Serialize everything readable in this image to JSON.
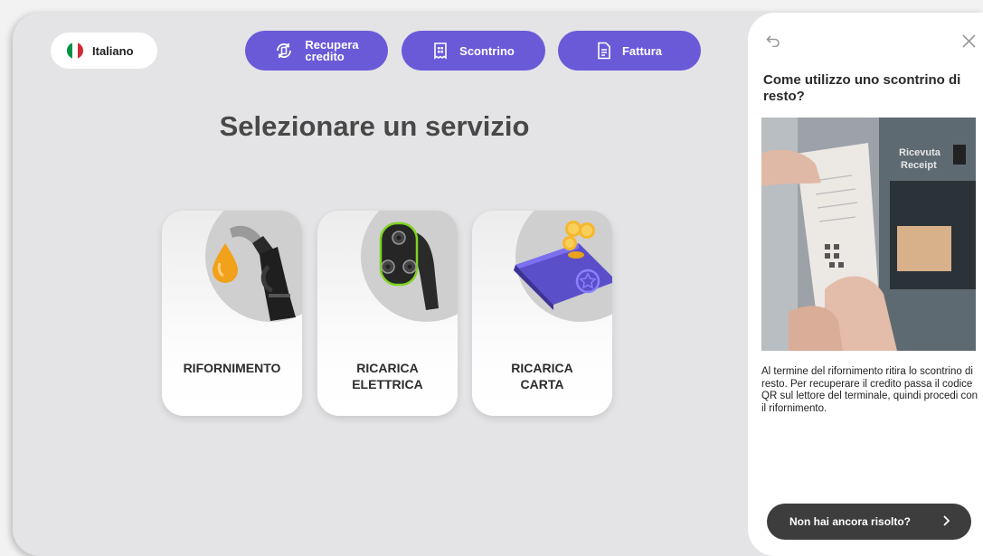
{
  "language": {
    "label": "Italiano",
    "flag_colors": [
      "#009246",
      "#ffffff",
      "#ce2b37"
    ]
  },
  "toolbar": {
    "recover": {
      "line1": "Recupera",
      "line2": "credito",
      "icon": "coin-refresh-icon"
    },
    "receipt": {
      "label": "Scontrino",
      "icon": "receipt-icon"
    },
    "invoice": {
      "label": "Fattura",
      "icon": "document-icon"
    }
  },
  "main": {
    "heading": "Selezionare un servizio",
    "services": [
      {
        "label": "RIFORNIMENTO",
        "icon": "fuel-nozzle-icon"
      },
      {
        "label": "RICARICA\nELETTRICA",
        "icon": "ev-plug-icon"
      },
      {
        "label": "RICARICA\nCARTA",
        "icon": "card-coins-icon"
      }
    ]
  },
  "help_panel": {
    "title": "Come utilizzo uno scontrino di resto?",
    "photo_sign": [
      "Ricevuta",
      "Receipt"
    ],
    "body": "Al termine del rifornimento ritira lo scontrino di resto. Per recuperare il credito passa il codice QR sul lettore del terminale, quindi procedi con il rifornimento.",
    "button_label": "Non hai ancora risolto?"
  },
  "colors": {
    "accent": "#6a5ad8",
    "background": "#e4e4e6",
    "dark_button": "#3d3d3d"
  }
}
